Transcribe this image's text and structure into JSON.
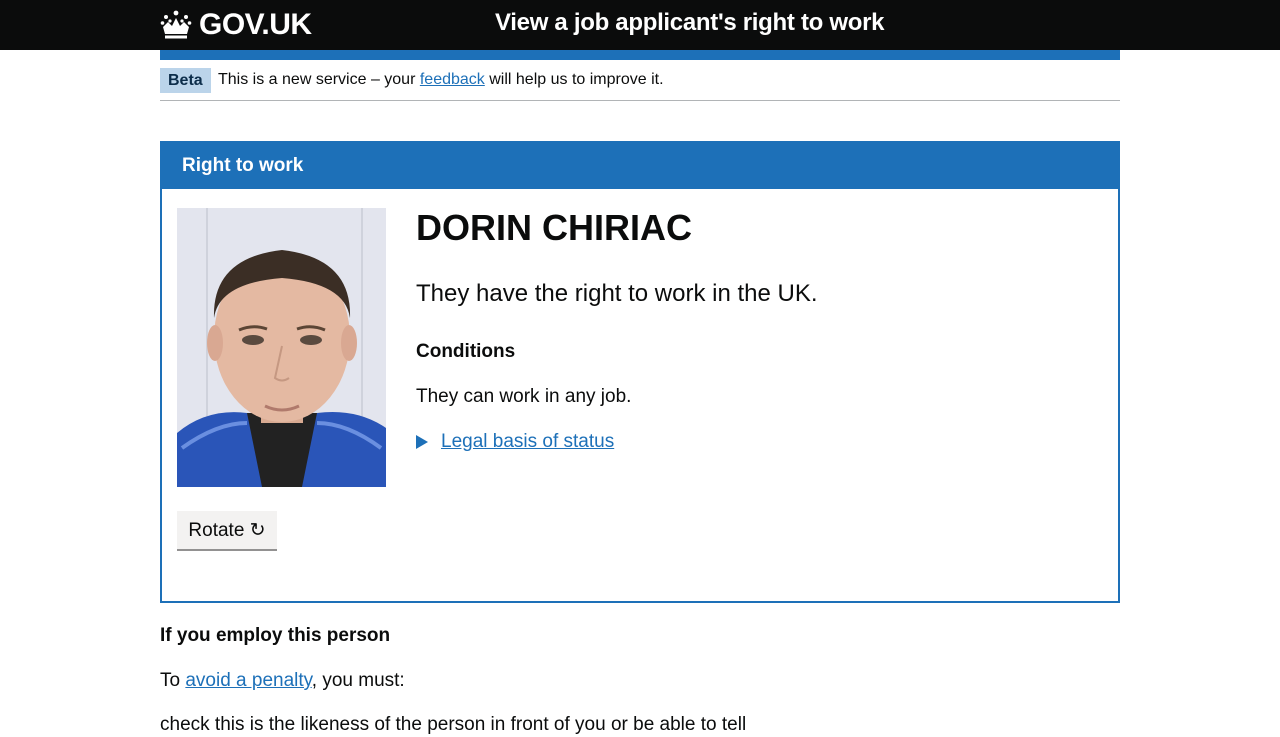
{
  "header": {
    "logo_text": "GOV.UK",
    "service_name": "View a job applicant's right to work"
  },
  "phase_banner": {
    "tag": "Beta",
    "text_before": "This is a new service – your ",
    "link": "feedback",
    "text_after": " will help us to improve it."
  },
  "panel": {
    "heading": "Right to work",
    "name": "DORIN CHIRIAC",
    "status": "They have the right to work in the UK.",
    "conditions_heading": "Conditions",
    "conditions_text": "They can work in any job.",
    "details_summary": "Legal basis of status",
    "rotate_button": "Rotate ↻"
  },
  "employ": {
    "heading": "If you employ this person",
    "text_before": "To ",
    "link": "avoid a penalty",
    "text_after": ", you must:",
    "partial_next_line": "check this is the likeness of the person in front of you or be able to tell"
  },
  "colors": {
    "header_bg": "#0b0c0c",
    "brand_blue": "#1d70b8",
    "phase_tag_bg": "#bbd4ea",
    "button_bg": "#f3f2f1"
  },
  "icons": {
    "logo": "crown-icon",
    "details": "triangle-right-icon"
  }
}
